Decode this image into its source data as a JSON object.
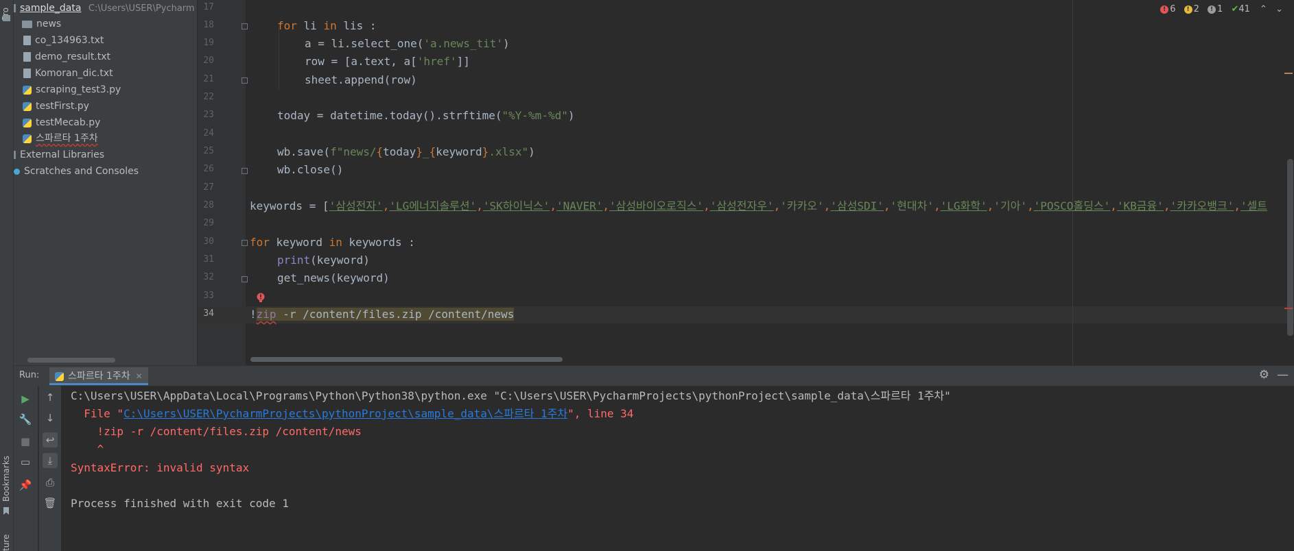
{
  "tool_strip": {
    "top_label": "Pro",
    "bookmarks_label": "Bookmarks",
    "structure_label": "ture"
  },
  "project": {
    "root_name": "sample_data",
    "root_path": "C:\\Users\\USER\\Pycharm",
    "items": [
      {
        "label": "news",
        "icon": "folder-icon"
      },
      {
        "label": "co_134963.txt",
        "icon": "text-file-icon"
      },
      {
        "label": "demo_result.txt",
        "icon": "text-file-icon"
      },
      {
        "label": "Komoran_dic.txt",
        "icon": "text-file-icon"
      },
      {
        "label": "scraping_test3.py",
        "icon": "python-file-icon"
      },
      {
        "label": "testFirst.py",
        "icon": "python-file-icon"
      },
      {
        "label": "testMecab.py",
        "icon": "python-file-icon"
      },
      {
        "label": "스파르타 1주차",
        "icon": "python-file-icon"
      }
    ],
    "external_libraries": "External Libraries",
    "scratches": "Scratches and Consoles"
  },
  "editor": {
    "line_numbers": [
      "17",
      "18",
      "19",
      "20",
      "21",
      "22",
      "23",
      "24",
      "25",
      "26",
      "27",
      "28",
      "29",
      "30",
      "31",
      "32",
      "33",
      "34"
    ],
    "current_line": "34",
    "inspections": {
      "errors": "6",
      "warnings": "2",
      "weak_warnings": "1",
      "typos": "41"
    },
    "code": {
      "l18_kw1": "for",
      "l18_a": " li ",
      "l18_kw2": "in",
      "l18_b": " lis :",
      "l19_a": "a = li.select_one(",
      "l19_str": "'a.news_tit'",
      "l19_b": ")",
      "l20_a": "row = [a.text, a[",
      "l20_str": "'href'",
      "l20_b": "]]",
      "l21": "sheet.append(row)",
      "l23_a": "today = datetime.today().strftime(",
      "l23_str": "\"%Y-%m-%d\"",
      "l23_b": ")",
      "l25_a": "wb.save(",
      "l25_s1": "f\"news/",
      "l25_b1": "{",
      "l25_v1": "today",
      "l25_b2": "}",
      "l25_s2": "_",
      "l25_b3": "{",
      "l25_v2": "keyword",
      "l25_b4": "}",
      "l25_s3": ".xlsx\"",
      "l25_c": ")",
      "l26": "wb.close()",
      "l28_a": "keywords = [",
      "l28_k1": "'삼성전자'",
      "l28_k2": "'LG에너지솔루션'",
      "l28_k3": "'SK하이닉스'",
      "l28_k4": "'NAVER'",
      "l28_k5": "'삼성바이오로직스'",
      "l28_k6": "'삼성전자우'",
      "l28_k7": "'카카오'",
      "l28_k8": "'삼성SDI'",
      "l28_k9": "'현대차'",
      "l28_k10": "'LG화학'",
      "l28_k11": "'기아'",
      "l28_k12": "'POSCO홀딩스'",
      "l28_k13": "'KB금융'",
      "l28_k14": "'카카오뱅크'",
      "l28_k15": "'셀트",
      "comma": ",",
      "l30_kw1": "for",
      "l30_a": " keyword ",
      "l30_kw2": "in",
      "l30_b": " keywords :",
      "l31_fn": "print",
      "l31_b": "(keyword)",
      "l32": "get_news(keyword)",
      "l34_bang": "!",
      "l34_zip": "zip",
      "l34_rest": " -r /content/files.zip /content/news"
    }
  },
  "run_panel": {
    "label": "Run:",
    "tab_label": "스파르타 1주차",
    "console": {
      "cmd": "C:\\Users\\USER\\AppData\\Local\\Programs\\Python\\Python38\\python.exe \"C:\\Users\\USER\\PycharmProjects\\pythonProject\\sample_data\\스파르타 1주차\"",
      "file_prefix": "  File \"",
      "file_link": "C:\\Users\\USER\\PycharmProjects\\pythonProject\\sample_data\\스파르타 1주차",
      "file_suffix": "\", line 34",
      "src_line": "    !zip -r /content/files.zip /content/news",
      "caret": "    ^",
      "error": "SyntaxError: invalid syntax",
      "exit": "Process finished with exit code 1"
    }
  }
}
